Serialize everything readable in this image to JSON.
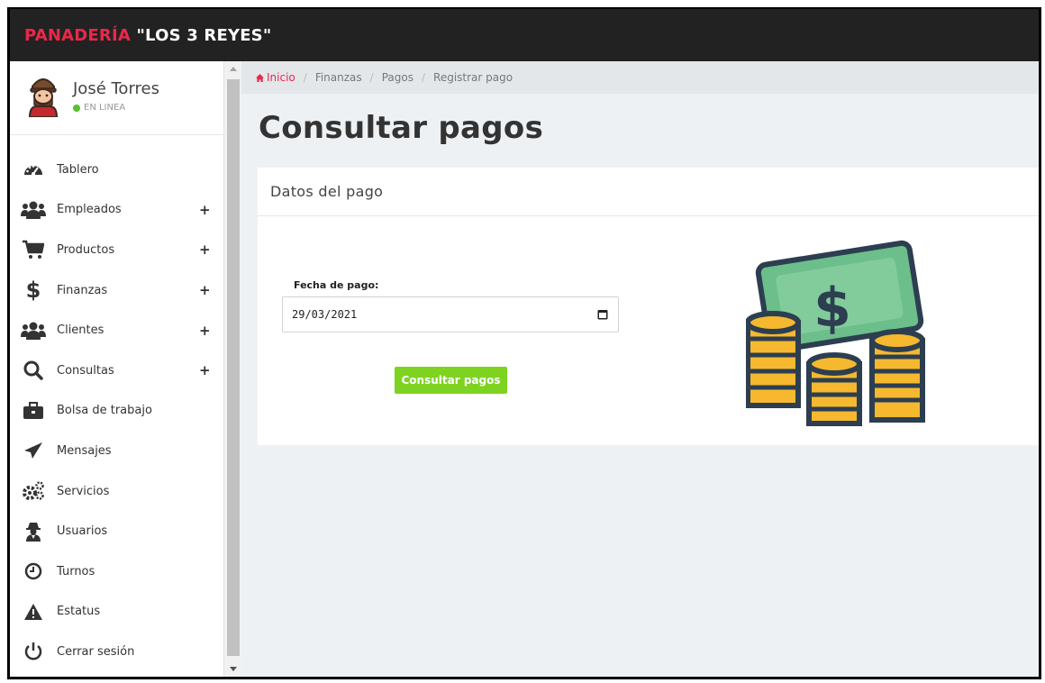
{
  "brand": {
    "part1": "PANADERÍA",
    "part2": "\"LOS 3 REYES\""
  },
  "user": {
    "name": "José Torres",
    "status": "EN LINEA"
  },
  "sidebar": {
    "items": [
      {
        "label": "Tablero",
        "icon": "dashboard-icon",
        "expandable": false
      },
      {
        "label": "Empleados",
        "icon": "users-icon",
        "expandable": true
      },
      {
        "label": "Productos",
        "icon": "cart-icon",
        "expandable": true
      },
      {
        "label": "Finanzas",
        "icon": "dollar-icon",
        "expandable": true
      },
      {
        "label": "Clientes",
        "icon": "users-icon",
        "expandable": true
      },
      {
        "label": "Consultas",
        "icon": "search-icon",
        "expandable": true
      },
      {
        "label": "Bolsa de trabajo",
        "icon": "briefcase-icon",
        "expandable": false
      },
      {
        "label": "Mensajes",
        "icon": "paper-plane-icon",
        "expandable": false
      },
      {
        "label": "Servicios",
        "icon": "gears-icon",
        "expandable": false
      },
      {
        "label": "Usuarios",
        "icon": "user-secret-icon",
        "expandable": false
      },
      {
        "label": "Turnos",
        "icon": "clock-icon",
        "expandable": false
      },
      {
        "label": "Estatus",
        "icon": "warning-icon",
        "expandable": false
      },
      {
        "label": "Cerrar sesión",
        "icon": "power-icon",
        "expandable": false
      }
    ],
    "expand_symbol": "+"
  },
  "breadcrumb": {
    "items": [
      "Inicio",
      "Finanzas",
      "Pagos",
      "Registrar pago"
    ],
    "separator": "/"
  },
  "page": {
    "title": "Consultar pagos"
  },
  "panel": {
    "title": "Datos del pago",
    "date_label": "Fecha de pago:",
    "date_value": "29/03/2021",
    "submit_label": "Consultar pagos"
  },
  "colors": {
    "brand_red": "#e8294a",
    "topbar": "#222222",
    "button_green": "#7ed321",
    "status_green": "#56c12d"
  }
}
